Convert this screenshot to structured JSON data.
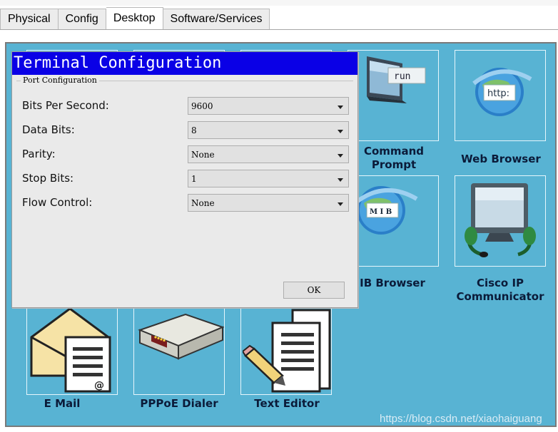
{
  "tabs": [
    {
      "label": "Physical",
      "active": false
    },
    {
      "label": "Config",
      "active": false
    },
    {
      "label": "Desktop",
      "active": true
    },
    {
      "label": "Software/Services",
      "active": false
    }
  ],
  "desktop": {
    "apps": {
      "command_prompt": {
        "label_line1": "Command",
        "label_line2": "Prompt",
        "icon": "terminal-icon",
        "icon_text": "run"
      },
      "web_browser": {
        "label": "Web Browser",
        "icon": "globe-icon",
        "icon_text": "http:"
      },
      "mib_browser": {
        "label": "IB Browser",
        "icon": "mib-globe-icon",
        "icon_text": "M I B"
      },
      "cisco_ip_communicator": {
        "label_line1": "Cisco IP",
        "label_line2": "Communicator",
        "icon": "softphone-icon"
      },
      "email": {
        "label": "E Mail",
        "icon": "envelope-icon"
      },
      "pppoe_dialer": {
        "label": "PPPoE Dialer",
        "icon": "modem-icon"
      },
      "text_editor": {
        "label": "Text Editor",
        "icon": "document-pencil-icon"
      }
    },
    "background_color": "#58b3d3"
  },
  "dialog": {
    "title": "Terminal Configuration",
    "group_label": "Port Configuration",
    "fields": [
      {
        "label": "Bits Per Second:",
        "value": "9600"
      },
      {
        "label": "Data Bits:",
        "value": "8"
      },
      {
        "label": "Parity:",
        "value": "None"
      },
      {
        "label": "Stop Bits:",
        "value": "1"
      },
      {
        "label": "Flow Control:",
        "value": "None"
      }
    ],
    "ok_label": "OK",
    "title_bar_color": "#0a00e6"
  },
  "watermark": "https://blog.csdn.net/xiaohaiguang"
}
